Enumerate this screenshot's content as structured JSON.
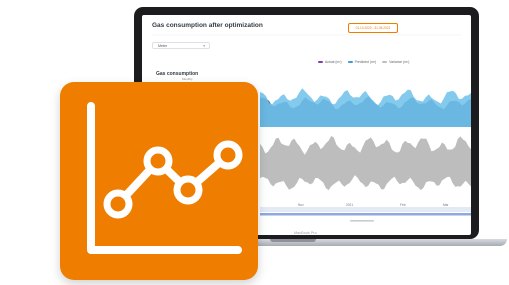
{
  "screen": {
    "title": "Gas consumption after optimization",
    "date_range": "01.10.2020 - 31.05.2021",
    "filter_value": "Meter",
    "chart": {
      "title": "Gas consumption",
      "subtitle": "Monthly",
      "legend": [
        {
          "label": "Actual (m³)",
          "color": "#7a3fb3"
        },
        {
          "label": "Predicted (m³)",
          "color": "#3d9bd6"
        },
        {
          "label": "Variance (m³)",
          "color": "#bfbfbf"
        }
      ],
      "x_labels": [
        "Nov",
        "2021",
        "Feb",
        "Mar"
      ]
    }
  },
  "laptop": {
    "brand": "MacBook Pro"
  },
  "logo": {
    "icon": "line-chart-icon",
    "color": "#ef7d00"
  }
}
